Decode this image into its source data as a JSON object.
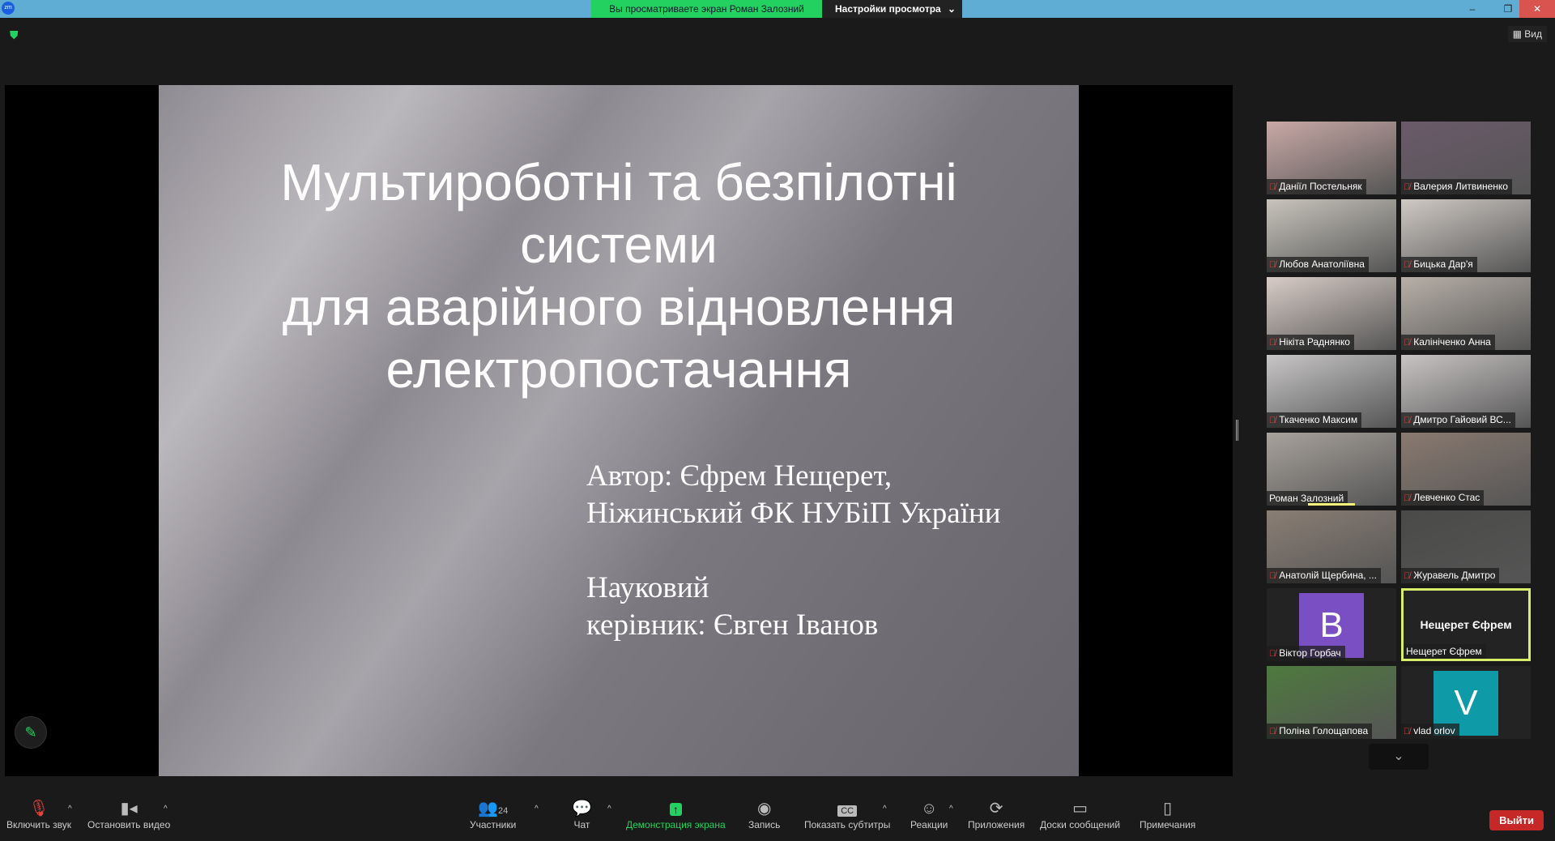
{
  "window": {
    "app_icon": "zm",
    "banner": "Вы просматриваете экран Роман Залозний",
    "view_options": "Настройки просмотра",
    "view_button": "Вид"
  },
  "slide": {
    "title_lines": [
      "Мультироботні та безпілотні",
      "системи",
      "для аварійного відновлення",
      "електропостачання"
    ],
    "author_lines": [
      "Автор: Єфрем Нещерет,",
      "Ніжинський ФК НУБіП України",
      "",
      "Науковий",
      "керівник: Євген Іванов"
    ]
  },
  "participants": [
    {
      "name": "Даніїл Постельняк",
      "muted": true,
      "bg": "#c9a9a6"
    },
    {
      "name": "Валерия Литвиненко",
      "muted": true,
      "bg": "#6b5a6a"
    },
    {
      "name": "Любов Анатоліївна",
      "muted": true,
      "bg": "#c8c4bc"
    },
    {
      "name": "Бицька Дар'я",
      "muted": true,
      "bg": "#cfc9c4"
    },
    {
      "name": "Нікіта Раднянко",
      "muted": true,
      "bg": "#d8ccc6"
    },
    {
      "name": "Калініченко Анна",
      "muted": true,
      "bg": "#b8b0a8"
    },
    {
      "name": "Ткаченко Максим",
      "muted": true,
      "bg": "#c8c6c6"
    },
    {
      "name": "Дмитро Гайовий ВС...",
      "muted": true,
      "bg": "#c9c4c4"
    },
    {
      "name": "Роман Залозний",
      "muted": false,
      "bg": "#a8a29c"
    },
    {
      "name": "Левченко Стас",
      "muted": true,
      "bg": "#8a7a70"
    },
    {
      "name": "Анатолій Щербина, ...",
      "muted": true,
      "bg": "#8a7e74"
    },
    {
      "name": "Журавель Дмитро",
      "muted": true,
      "bg": "#4a4a48"
    },
    {
      "name": "Віктор Горбач",
      "muted": true,
      "avatar": "B",
      "avatar_color": "#7b4fc4"
    },
    {
      "name": "Нещерет Єфрем",
      "muted": false,
      "center_name": "Нещерет Єфрем",
      "active": true
    },
    {
      "name": "Поліна Голощапова",
      "muted": true,
      "bg": "#4e7a3e"
    },
    {
      "name": "vlad orlov",
      "muted": true,
      "avatar": "V",
      "avatar_color": "#0e9aa7"
    }
  ],
  "toolbar": {
    "unmute": "Включить звук",
    "stop_video": "Остановить видео",
    "participants": "Участники",
    "participants_count": "24",
    "chat": "Чат",
    "share": "Демонстрация экрана",
    "record": "Запись",
    "captions": "Показать субтитры",
    "cc": "CC",
    "reactions": "Реакции",
    "apps": "Приложения",
    "whiteboards": "Доски сообщений",
    "notes": "Примечания",
    "leave": "Выйти"
  }
}
